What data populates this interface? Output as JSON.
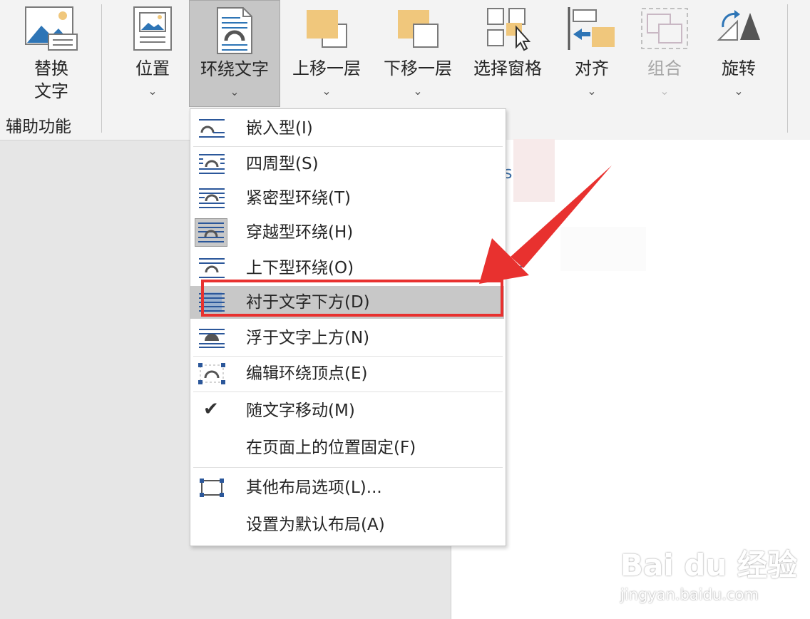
{
  "ribbon": {
    "alt_text": {
      "line1": "替换",
      "line2": "文字"
    },
    "group_label": "辅助功能",
    "position": {
      "label": "位置",
      "chevron": "⌄"
    },
    "wrap_text": {
      "label": "环绕文字",
      "chevron": "⌄"
    },
    "bring_forward": {
      "label": "上移一层",
      "chevron": "⌄"
    },
    "send_backward": {
      "label": "下移一层",
      "chevron": "⌄"
    },
    "selection_pane": {
      "label": "选择窗格"
    },
    "align": {
      "label": "对齐",
      "chevron": "⌄"
    },
    "group": {
      "label": "组合",
      "chevron": "⌄"
    },
    "rotate": {
      "label": "旋转",
      "chevron": "⌄"
    }
  },
  "menu": {
    "items": [
      {
        "label": "嵌入型(I)",
        "icon": "inline-wrap-icon"
      },
      {
        "label": "四周型(S)",
        "icon": "square-wrap-icon"
      },
      {
        "label": "紧密型环绕(T)",
        "icon": "tight-wrap-icon"
      },
      {
        "label": "穿越型环绕(H)",
        "icon": "through-wrap-icon"
      },
      {
        "label": "上下型环绕(O)",
        "icon": "top-bottom-wrap-icon"
      },
      {
        "label": "衬于文字下方(D)",
        "icon": "behind-text-icon"
      },
      {
        "label": "浮于文字上方(N)",
        "icon": "in-front-text-icon"
      },
      {
        "label": "编辑环绕顶点(E)",
        "icon": "edit-wrap-points-icon"
      },
      {
        "label": "随文字移动(M)",
        "icon": "checkmark-icon"
      },
      {
        "label": "在页面上的位置固定(F)"
      },
      {
        "label": "其他布局选项(L)...",
        "icon": "layout-options-icon"
      },
      {
        "label": "设置为默认布局(A)"
      }
    ],
    "checkmark": "✔"
  },
  "watermark": {
    "brand": "Bai du 经验",
    "url": "jingyan.baidu.com"
  },
  "colors": {
    "highlight": "#c8c8c8",
    "annotation_red": "#e8312f",
    "icon_blue": "#2b579a",
    "icon_orange": "#f0c77c"
  }
}
